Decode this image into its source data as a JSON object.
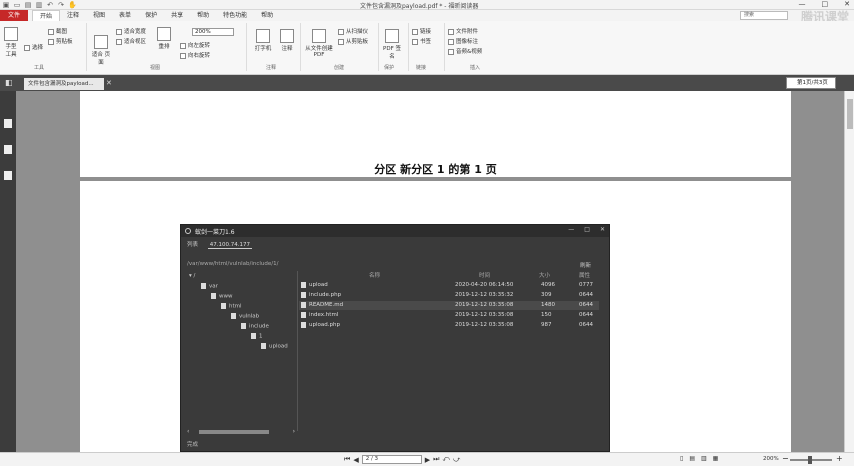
{
  "window": {
    "title": "文件包含漏洞及payload.pdf * - 福昕阅读器",
    "quick_access": [
      "new-icon",
      "open-icon",
      "save-icon",
      "print-icon",
      "undo-icon",
      "redo-icon",
      "hand-icon"
    ],
    "controls": [
      "—",
      "□",
      "✕"
    ]
  },
  "menu": {
    "file_label": "文件",
    "tabs": [
      "开始",
      "注释",
      "视图",
      "表单",
      "保护",
      "共享",
      "帮助",
      "特色功能",
      "帮助"
    ],
    "active_tab": "开始",
    "search_placeholder": "搜索"
  },
  "brand": "腾讯课堂",
  "ribbon": {
    "hand_tool": "手型\n工具",
    "select": "选择",
    "snapshot": "截图",
    "clipboard": "剪贴板",
    "group_tools": "工具",
    "fit_page": "适合\n页面",
    "fit_width": "适合宽度",
    "fit_visible": "适合视区",
    "reflow": "重排",
    "rotate_left": "向左旋转",
    "rotate_right": "向右旋转",
    "zoom_value": "200%",
    "group_view": "视图",
    "typewriter": "打字机",
    "annotate": "注释",
    "group_comment": "注释",
    "convert_pdf": "从文件创建PDF",
    "from_scanner": "从扫描仪",
    "from_clipboard": "从剪贴板",
    "group_create": "创建",
    "pdf_sign": "PDF\n签名",
    "group_protect": "保护",
    "link": "链接",
    "bookmark": "书签",
    "group_links": "链接",
    "file_attach": "文件附件",
    "image_annot": "图像标注",
    "audio_video": "音频&视频",
    "group_insert": "插入"
  },
  "doc_tab": {
    "title": "文件包含漏洞及payload...",
    "right_panel": "第1页/共3页"
  },
  "page": {
    "heading": "分区 新分区 1 的第 1 页"
  },
  "app": {
    "title": "蚁剑一菜刀1.6",
    "list_label": "列表",
    "address": "47.100.74.177",
    "path": "/var/www/html/vulnlab/include/1/",
    "refresh": "刷新",
    "tree": [
      "/",
      "var",
      "www",
      "html",
      "vulnlab",
      "include",
      "1",
      "upload"
    ],
    "columns": [
      "名称",
      "时间",
      "大小",
      "属性"
    ],
    "files": [
      {
        "name": "upload",
        "time": "2020-04-20 06:14:50",
        "size": "4096",
        "attr": "0777"
      },
      {
        "name": "include.php",
        "time": "2019-12-12 03:35:32",
        "size": "309",
        "attr": "0644"
      },
      {
        "name": "README.md",
        "time": "2019-12-12 03:35:08",
        "size": "1480",
        "attr": "0644"
      },
      {
        "name": "index.html",
        "time": "2019-12-12 03:35:08",
        "size": "150",
        "attr": "0644"
      },
      {
        "name": "upload.php",
        "time": "2019-12-12 03:35:08",
        "size": "987",
        "attr": "0644"
      }
    ],
    "status": "完成"
  },
  "status": {
    "page_input": "2 / 3",
    "zoom": "200%"
  }
}
